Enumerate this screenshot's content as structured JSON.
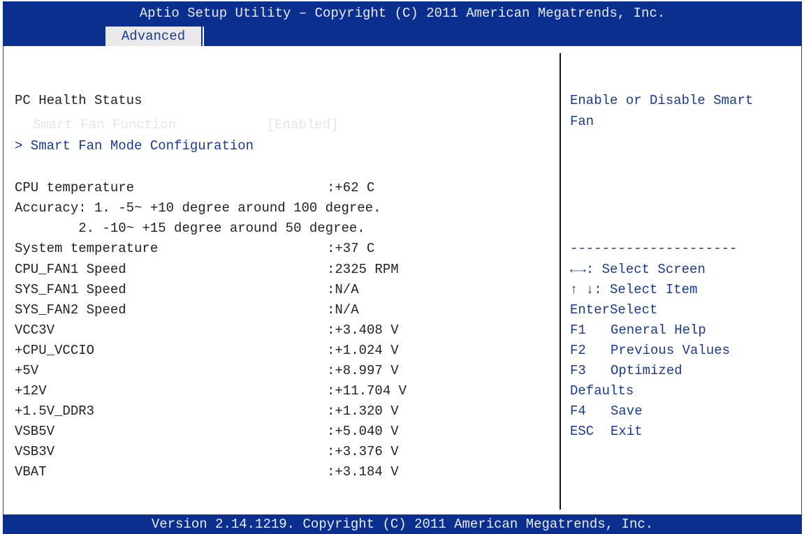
{
  "title_bar": "Aptio Setup Utility – Copyright (C) 2011 American Megatrends, Inc.",
  "tabs": [
    {
      "label": "Advanced",
      "active": true
    }
  ],
  "page_heading": "PC Health Status",
  "smart_fan": {
    "label": "Smart Fan Function",
    "value": "[Enabled]"
  },
  "submenu": "> Smart Fan Mode Configuration",
  "cpu_temperature": {
    "label": "CPU temperature",
    "value": ":+62 C"
  },
  "accuracy": [
    "Accuracy: 1. -5~ +10 degree around 100 degree.",
    "        2. -10~ +15 degree around 50 degree."
  ],
  "readings": [
    {
      "label": "System temperature",
      "value": ":+37 C"
    },
    {
      "label": "CPU_FAN1 Speed",
      "value": ":2325 RPM"
    },
    {
      "label": "SYS_FAN1 Speed",
      "value": ":N/A"
    },
    {
      "label": "SYS_FAN2 Speed",
      "value": ":N/A"
    },
    {
      "label": "VCC3V",
      "value": ":+3.408 V"
    },
    {
      "label": "+CPU_VCCIO",
      "value": ":+1.024 V"
    },
    {
      "label": "+5V",
      "value": ":+8.997 V"
    },
    {
      "label": "+12V",
      "value": ":+11.704 V"
    },
    {
      "label": "+1.5V_DDR3",
      "value": ":+1.320 V"
    },
    {
      "label": "VSB5V",
      "value": ":+5.040 V"
    },
    {
      "label": "VSB3V",
      "value": ":+3.376 V"
    },
    {
      "label": "VBAT",
      "value": ":+3.184 V"
    }
  ],
  "help": {
    "line1": "Enable or Disable Smart",
    "line2": "Fan",
    "separator": "---------------------"
  },
  "keys": [
    {
      "key": "←→",
      "action": ": Select Screen"
    },
    {
      "key": "↑ ↓",
      "action": ": Select Item"
    },
    {
      "key": "Enter",
      "action": "Select"
    },
    {
      "key": "F1",
      "action": "General Help"
    },
    {
      "key": "F2",
      "action": "Previous Values"
    },
    {
      "key": "F3",
      "action": "Optimized"
    },
    {
      "key": "",
      "action": "Defaults"
    },
    {
      "key": "F4",
      "action": "Save"
    },
    {
      "key": "ESC",
      "action": "Exit"
    }
  ],
  "footer": "Version 2.14.1219. Copyright (C) 2011 American Megatrends, Inc.",
  "colors": {
    "header_blue": "#0b2f8f",
    "text_blue": "#1a3a8f",
    "highlight": "#e4e4e4"
  }
}
